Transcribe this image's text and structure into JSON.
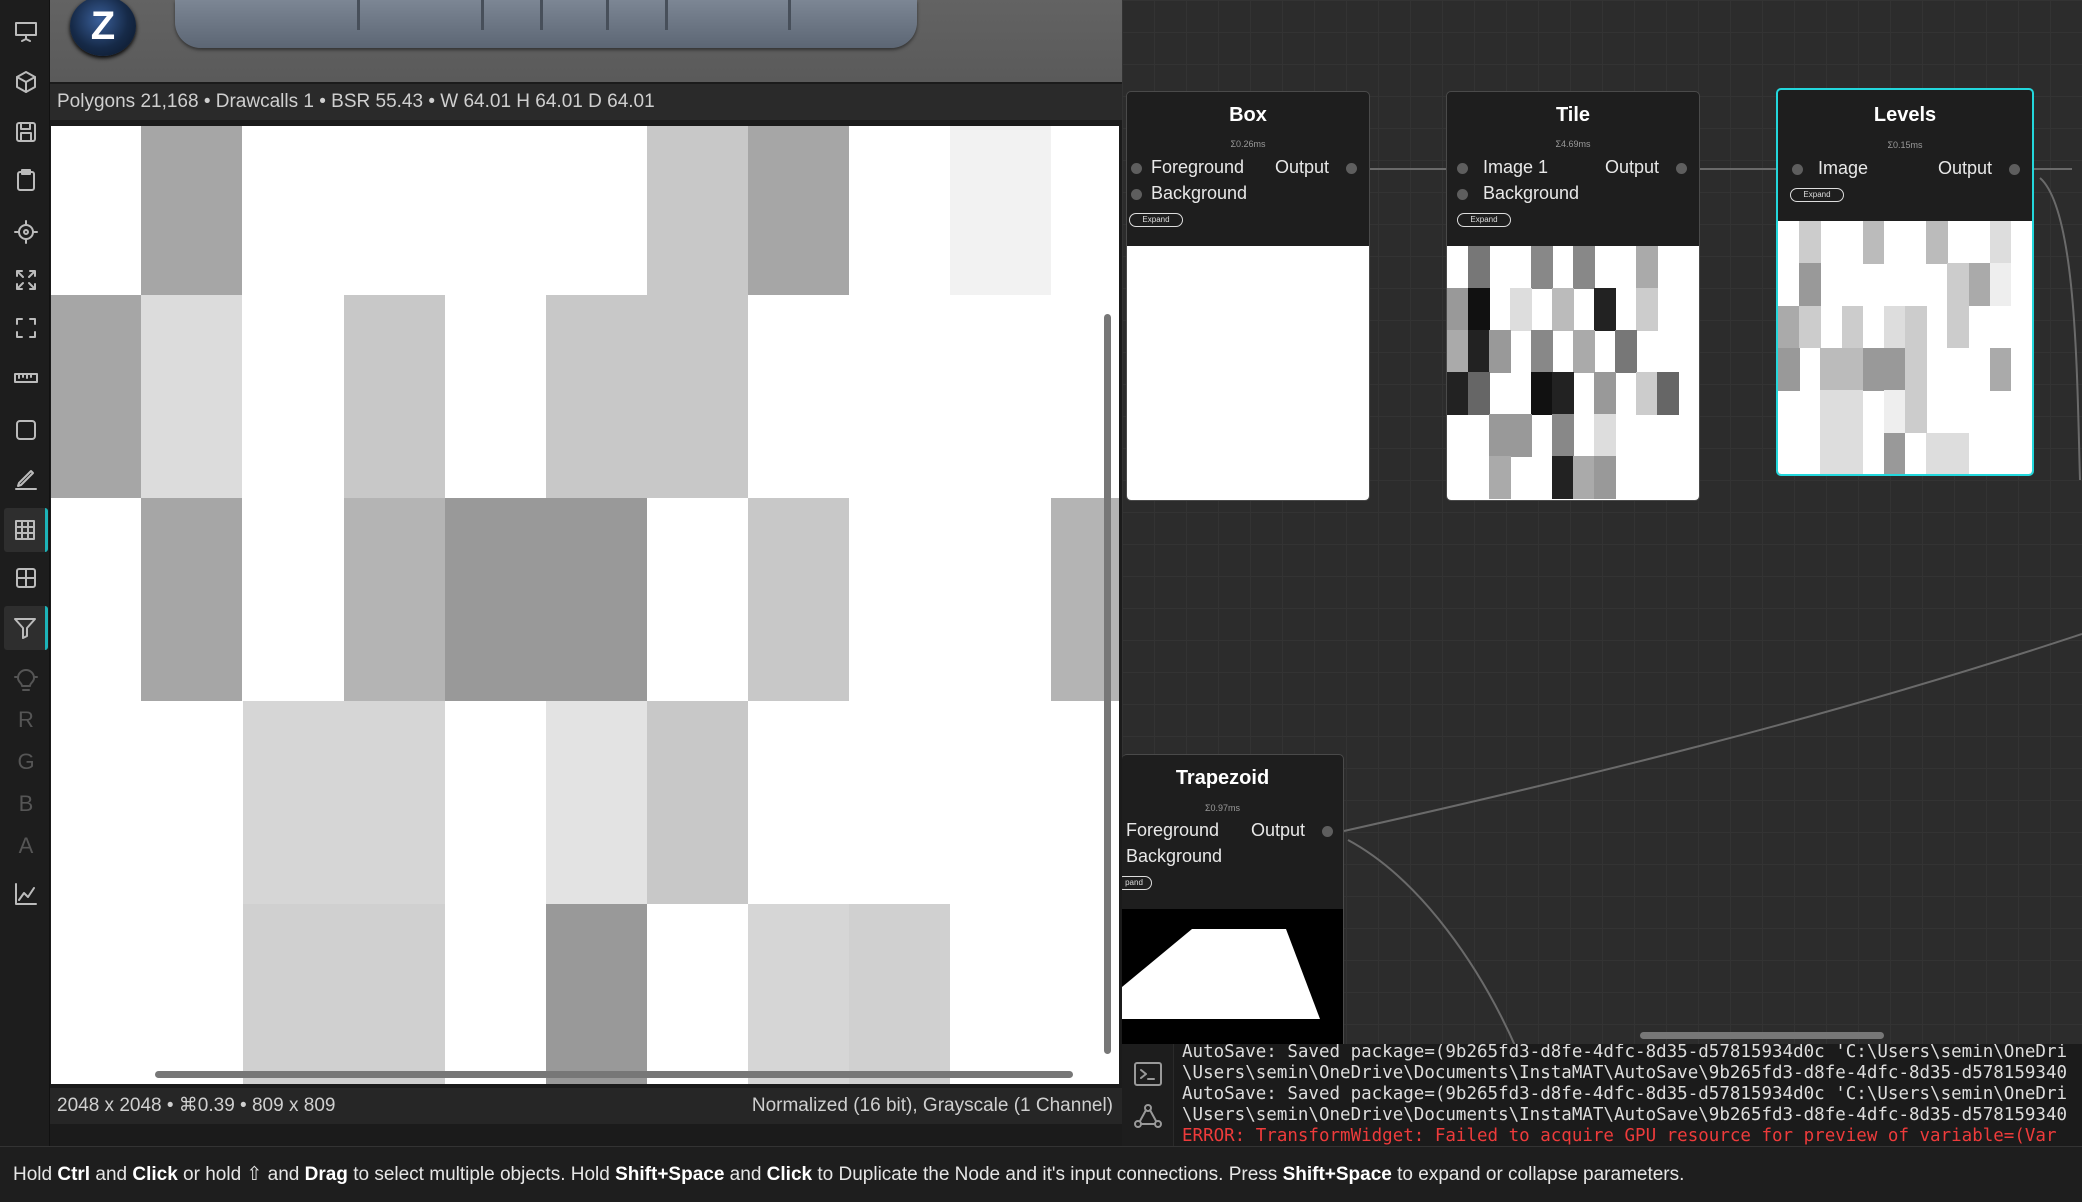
{
  "viewport": {
    "logo_letter": "Z",
    "mesh_info": "Polygons 21,168 • Drawcalls 1 • BSR 55.43 • W 64.01 H 64.01 D 64.01"
  },
  "texture_view": {
    "info_left": "2048 x 2048 • ⌘0.39 • 809 x 809",
    "info_right": "Normalized (16 bit), Grayscale (1 Channel)"
  },
  "sidebar": {
    "items": [
      {
        "name": "presentation-icon",
        "active": false
      },
      {
        "name": "cube-icon",
        "active": false
      },
      {
        "name": "save-icon",
        "active": false
      },
      {
        "name": "clipboard-icon",
        "active": false
      },
      {
        "name": "crosshair-icon",
        "active": false
      },
      {
        "name": "expand-arrows-icon",
        "active": false
      },
      {
        "name": "fit-frame-icon",
        "active": false
      },
      {
        "name": "ruler-icon",
        "active": false
      },
      {
        "name": "square-icon",
        "active": false
      },
      {
        "name": "pen-icon",
        "active": false
      },
      {
        "name": "checkerboard-icon",
        "active": true
      },
      {
        "name": "grid-icon",
        "active": false
      },
      {
        "name": "filter-icon",
        "active": true
      },
      {
        "name": "lightbulb-icon",
        "active": false
      },
      {
        "name": "chart-icon",
        "active": false
      }
    ],
    "channels": [
      "R",
      "G",
      "B",
      "A"
    ]
  },
  "nodes": [
    {
      "id": "box",
      "title": "Box",
      "time": "Σ0.26ms",
      "inputs": [
        "Foreground",
        "Background"
      ],
      "output": "Output",
      "expand": "Expand",
      "selected": false
    },
    {
      "id": "tile",
      "title": "Tile",
      "time": "Σ4.69ms",
      "inputs": [
        "Image 1",
        "Background"
      ],
      "output": "Output",
      "expand": "Expand",
      "selected": false
    },
    {
      "id": "levels",
      "title": "Levels",
      "time": "Σ0.15ms",
      "inputs": [
        "Image"
      ],
      "output": "Output",
      "expand": "Expand",
      "selected": true
    },
    {
      "id": "trapezoid",
      "title": "Trapezoid",
      "time": "Σ0.97ms",
      "inputs": [
        "Foreground",
        "Background"
      ],
      "output": "Output",
      "expand": "pand",
      "selected": false
    }
  ],
  "console": {
    "lines": [
      {
        "text": "AutoSave: Saved package=(9b265fd3-d8fe-4dfc-8d35-d57815934d0c 'C:\\Users\\semin\\OneDri",
        "error": false
      },
      {
        "text": "\\Users\\semin\\OneDrive\\Documents\\InstaMAT\\AutoSave\\9b265fd3-d8fe-4dfc-8d35-d578159340",
        "error": false
      },
      {
        "text": "AutoSave: Saved package=(9b265fd3-d8fe-4dfc-8d35-d57815934d0c 'C:\\Users\\semin\\OneDri",
        "error": false
      },
      {
        "text": "\\Users\\semin\\OneDrive\\Documents\\InstaMAT\\AutoSave\\9b265fd3-d8fe-4dfc-8d35-d578159340",
        "error": false
      },
      {
        "text": "ERROR: TransformWidget: Failed to acquire GPU resource for preview of variable=(Var",
        "error": true
      }
    ]
  },
  "status": {
    "parts": [
      {
        "t": "Hold ",
        "b": false
      },
      {
        "t": "Ctrl",
        "b": true
      },
      {
        "t": " and ",
        "b": false
      },
      {
        "t": "Click",
        "b": true
      },
      {
        "t": " or hold ⇧ and ",
        "b": false
      },
      {
        "t": "Drag",
        "b": true
      },
      {
        "t": " to select multiple objects. Hold ",
        "b": false
      },
      {
        "t": "Shift+Space",
        "b": true
      },
      {
        "t": " and ",
        "b": false
      },
      {
        "t": "Click",
        "b": true
      },
      {
        "t": " to Duplicate the Node and it's input connections. Press ",
        "b": false
      },
      {
        "t": "Shift+Space",
        "b": true
      },
      {
        "t": " to expand or collapse parameters.",
        "b": false
      }
    ]
  },
  "colors": {
    "accent": "#23d7dc",
    "error": "#ee3b3b",
    "panel": "#1e1e1e",
    "graph_bg": "#2c2c2c"
  }
}
